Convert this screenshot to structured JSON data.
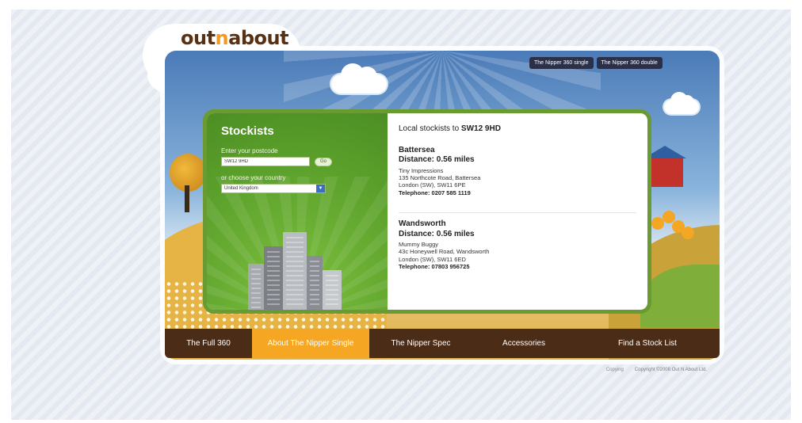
{
  "header": {
    "logo_prefix": "out",
    "logo_mid": "n",
    "logo_suffix": "about",
    "top_tabs": [
      "The Nipper 360 single",
      "The Nipper 360 double"
    ]
  },
  "stockists": {
    "title": "Stockists",
    "postcode_label": "Enter your postcode",
    "postcode_value": "SW12 9HD",
    "go_label": "Go",
    "country_label": "or choose your country",
    "country_value": "United Kingdom"
  },
  "results": {
    "heading_prefix": "Local stockists to ",
    "heading_postcode": "SW12 9HD",
    "stores": [
      {
        "area": "Battersea",
        "distance": "Distance: 0.56 miles",
        "name": "Tiny Impressions",
        "address": "135 Northcote Road, Battersea",
        "city": "London (SW), SW11 6PE",
        "phone": "Telephone: 0207 585 1119"
      },
      {
        "area": "Wandsworth",
        "distance": "Distance: 0.56 miles",
        "name": "Mummy Buggy",
        "address": "43c Honeywell Road, Wandsworth",
        "city": "London (SW), SW11 6ED",
        "phone": "Telephone: 07803 956725"
      }
    ]
  },
  "nav": {
    "items": [
      {
        "label": "The Full 360",
        "active": false
      },
      {
        "label": "About The Nipper Single",
        "active": true
      },
      {
        "label": "The Nipper Spec",
        "active": false
      },
      {
        "label": "Accessories",
        "active": false
      },
      {
        "label": "Find a Stock List",
        "active": false
      }
    ]
  },
  "footer": {
    "link": "Copying",
    "copyright": "Copyright ©2008 Out N About Ltd."
  },
  "colors": {
    "nav_bg": "#4b2c17",
    "nav_active": "#f5a623",
    "panel_green": "#5da22c",
    "top_tab_bg": "#2a3049"
  }
}
